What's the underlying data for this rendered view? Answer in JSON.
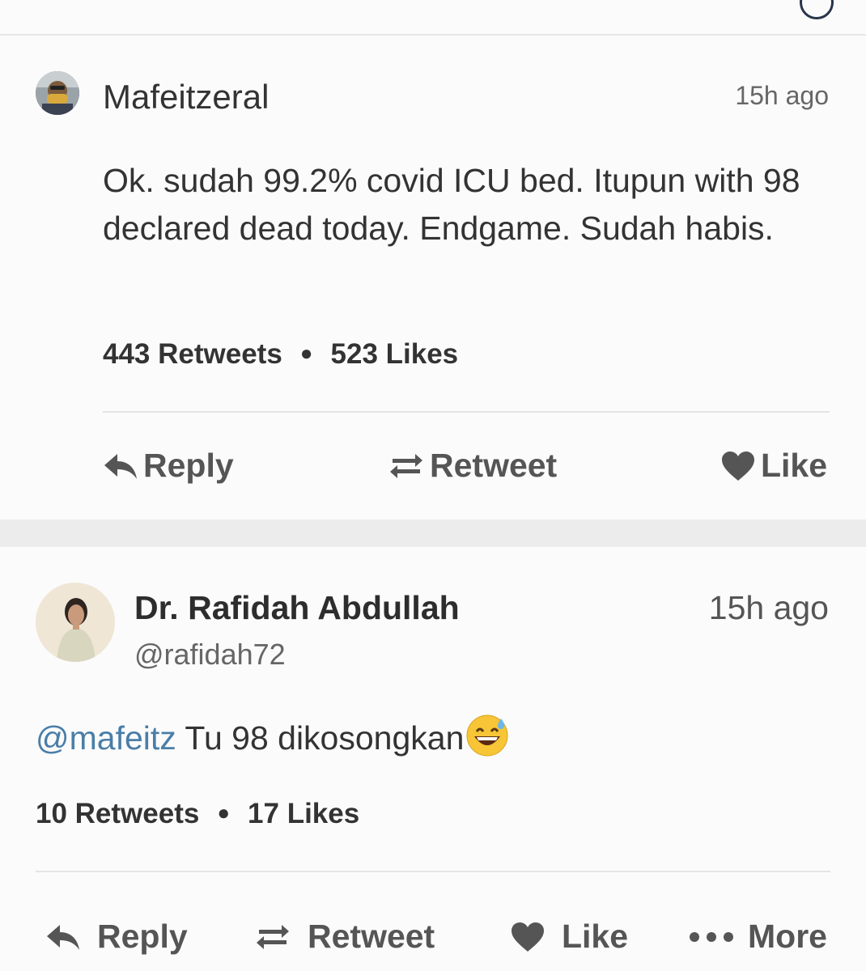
{
  "header": {
    "back_icon": "chevron-left-icon",
    "profile_icon": "profile-circle-icon"
  },
  "tweets": [
    {
      "name": "Mafeitzeral",
      "time": "15h ago",
      "text": "Ok. sudah 99.2% covid ICU bed. Itupun with 98 declared dead today. Endgame. Sudah habis.",
      "retweets": "443 Retweets",
      "likes": "523 Likes",
      "actions": {
        "reply": "Reply",
        "retweet": "Retweet",
        "like": "Like"
      }
    },
    {
      "name": "Dr. Rafidah Abdullah",
      "handle": "@rafidah72",
      "time": "15h ago",
      "mention": "@mafeitz",
      "text": " Tu 98 dikosongkan",
      "emoji": "grinning-face-with-sweat-emoji",
      "retweets": "10 Retweets",
      "likes": "17 Likes",
      "actions": {
        "reply": "Reply",
        "retweet": "Retweet",
        "like": "Like",
        "more": "More"
      }
    }
  ],
  "colors": {
    "mention": "#4a7ea8",
    "action_gray": "#555555",
    "separator": "#ececec"
  }
}
